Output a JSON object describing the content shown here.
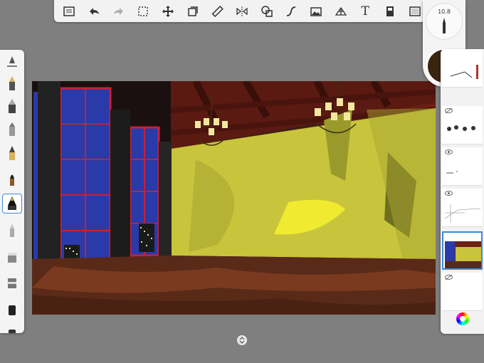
{
  "toolbar": {
    "icons": [
      "list-icon",
      "undo-icon",
      "redo-icon",
      "selection-icon",
      "move-icon",
      "copy-icon",
      "ruler-icon",
      "symmetry-icon",
      "shapes-icon",
      "stroke-icon",
      "image-icon",
      "perspective-icon",
      "text-icon",
      "bookmark-icon",
      "canvas-icon"
    ],
    "text_tool_label": "T"
  },
  "brush_size": "10.8",
  "current_color": "#3a2410",
  "brushes": [
    "pencil",
    "hard-pencil",
    "felt-pen",
    "marker",
    "ink-pen",
    "paint-brush",
    "chisel-brush",
    "airbrush",
    "eraser-1",
    "eraser-2",
    "eraser-3",
    "smudge"
  ],
  "selected_brush": 6,
  "layers": [
    {
      "visible": true,
      "selected": false
    },
    {
      "visible": false,
      "selected": false
    },
    {
      "visible": true,
      "selected": false
    },
    {
      "visible": true,
      "selected": false
    },
    {
      "visible": true,
      "selected": true
    },
    {
      "visible": false,
      "selected": false
    }
  ]
}
